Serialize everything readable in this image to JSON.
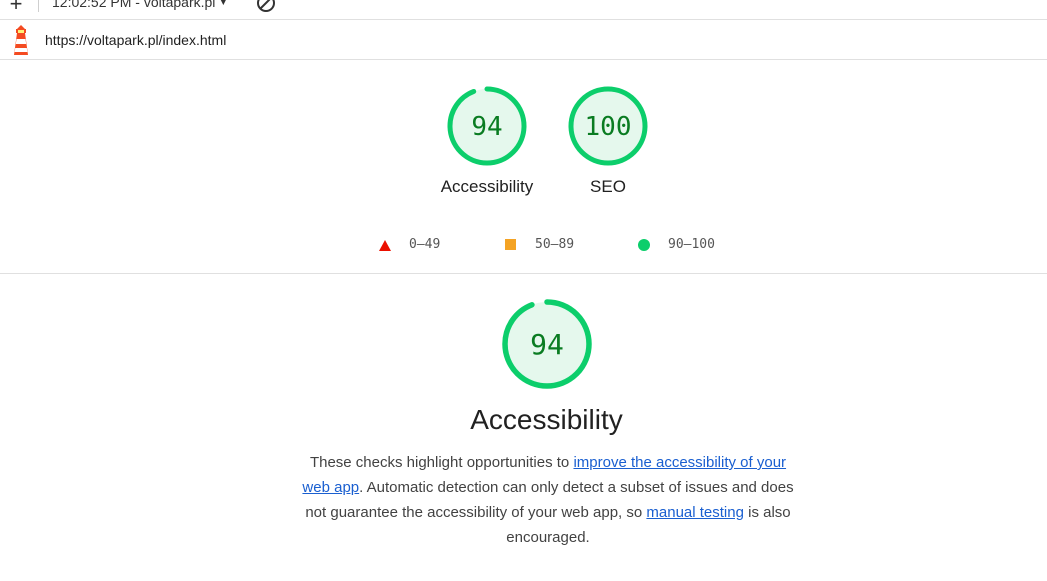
{
  "toolbar": {
    "new_report_symbol": "+",
    "report_select_label": "12:02:52 PM - voltapark.pl",
    "icons": [
      "plus-icon",
      "chevron-down-icon",
      "blocked-icon"
    ]
  },
  "urlbar": {
    "url": "https://voltapark.pl/index.html",
    "logo_icon": "lighthouse-icon"
  },
  "gauges": [
    {
      "label": "Accessibility",
      "score": "94",
      "value": 94
    },
    {
      "label": "SEO",
      "score": "100",
      "value": 100
    }
  ],
  "legend": [
    {
      "range": "0–49",
      "shape": "triangle",
      "color": "#eb0f00"
    },
    {
      "range": "50–89",
      "shape": "square",
      "color": "#f4a324"
    },
    {
      "range": "90–100",
      "shape": "circle",
      "color": "#0cce6b"
    }
  ],
  "category": {
    "score": "94",
    "value": 94,
    "title": "Accessibility",
    "description": {
      "text_before": "These checks highlight opportunities to ",
      "link1": "improve the accessibility of your web app",
      "text_middle": ". Automatic detection can only detect a subset of issues and does not guarantee the accessibility of your web app, so ",
      "link2": "manual testing",
      "text_after": " is also encouraged."
    }
  },
  "colors": {
    "pass_ring": "#0cce6b",
    "pass_fill": "#e5f8ed",
    "pass_text": "#0a7c22",
    "link": "#1a5fd0"
  }
}
